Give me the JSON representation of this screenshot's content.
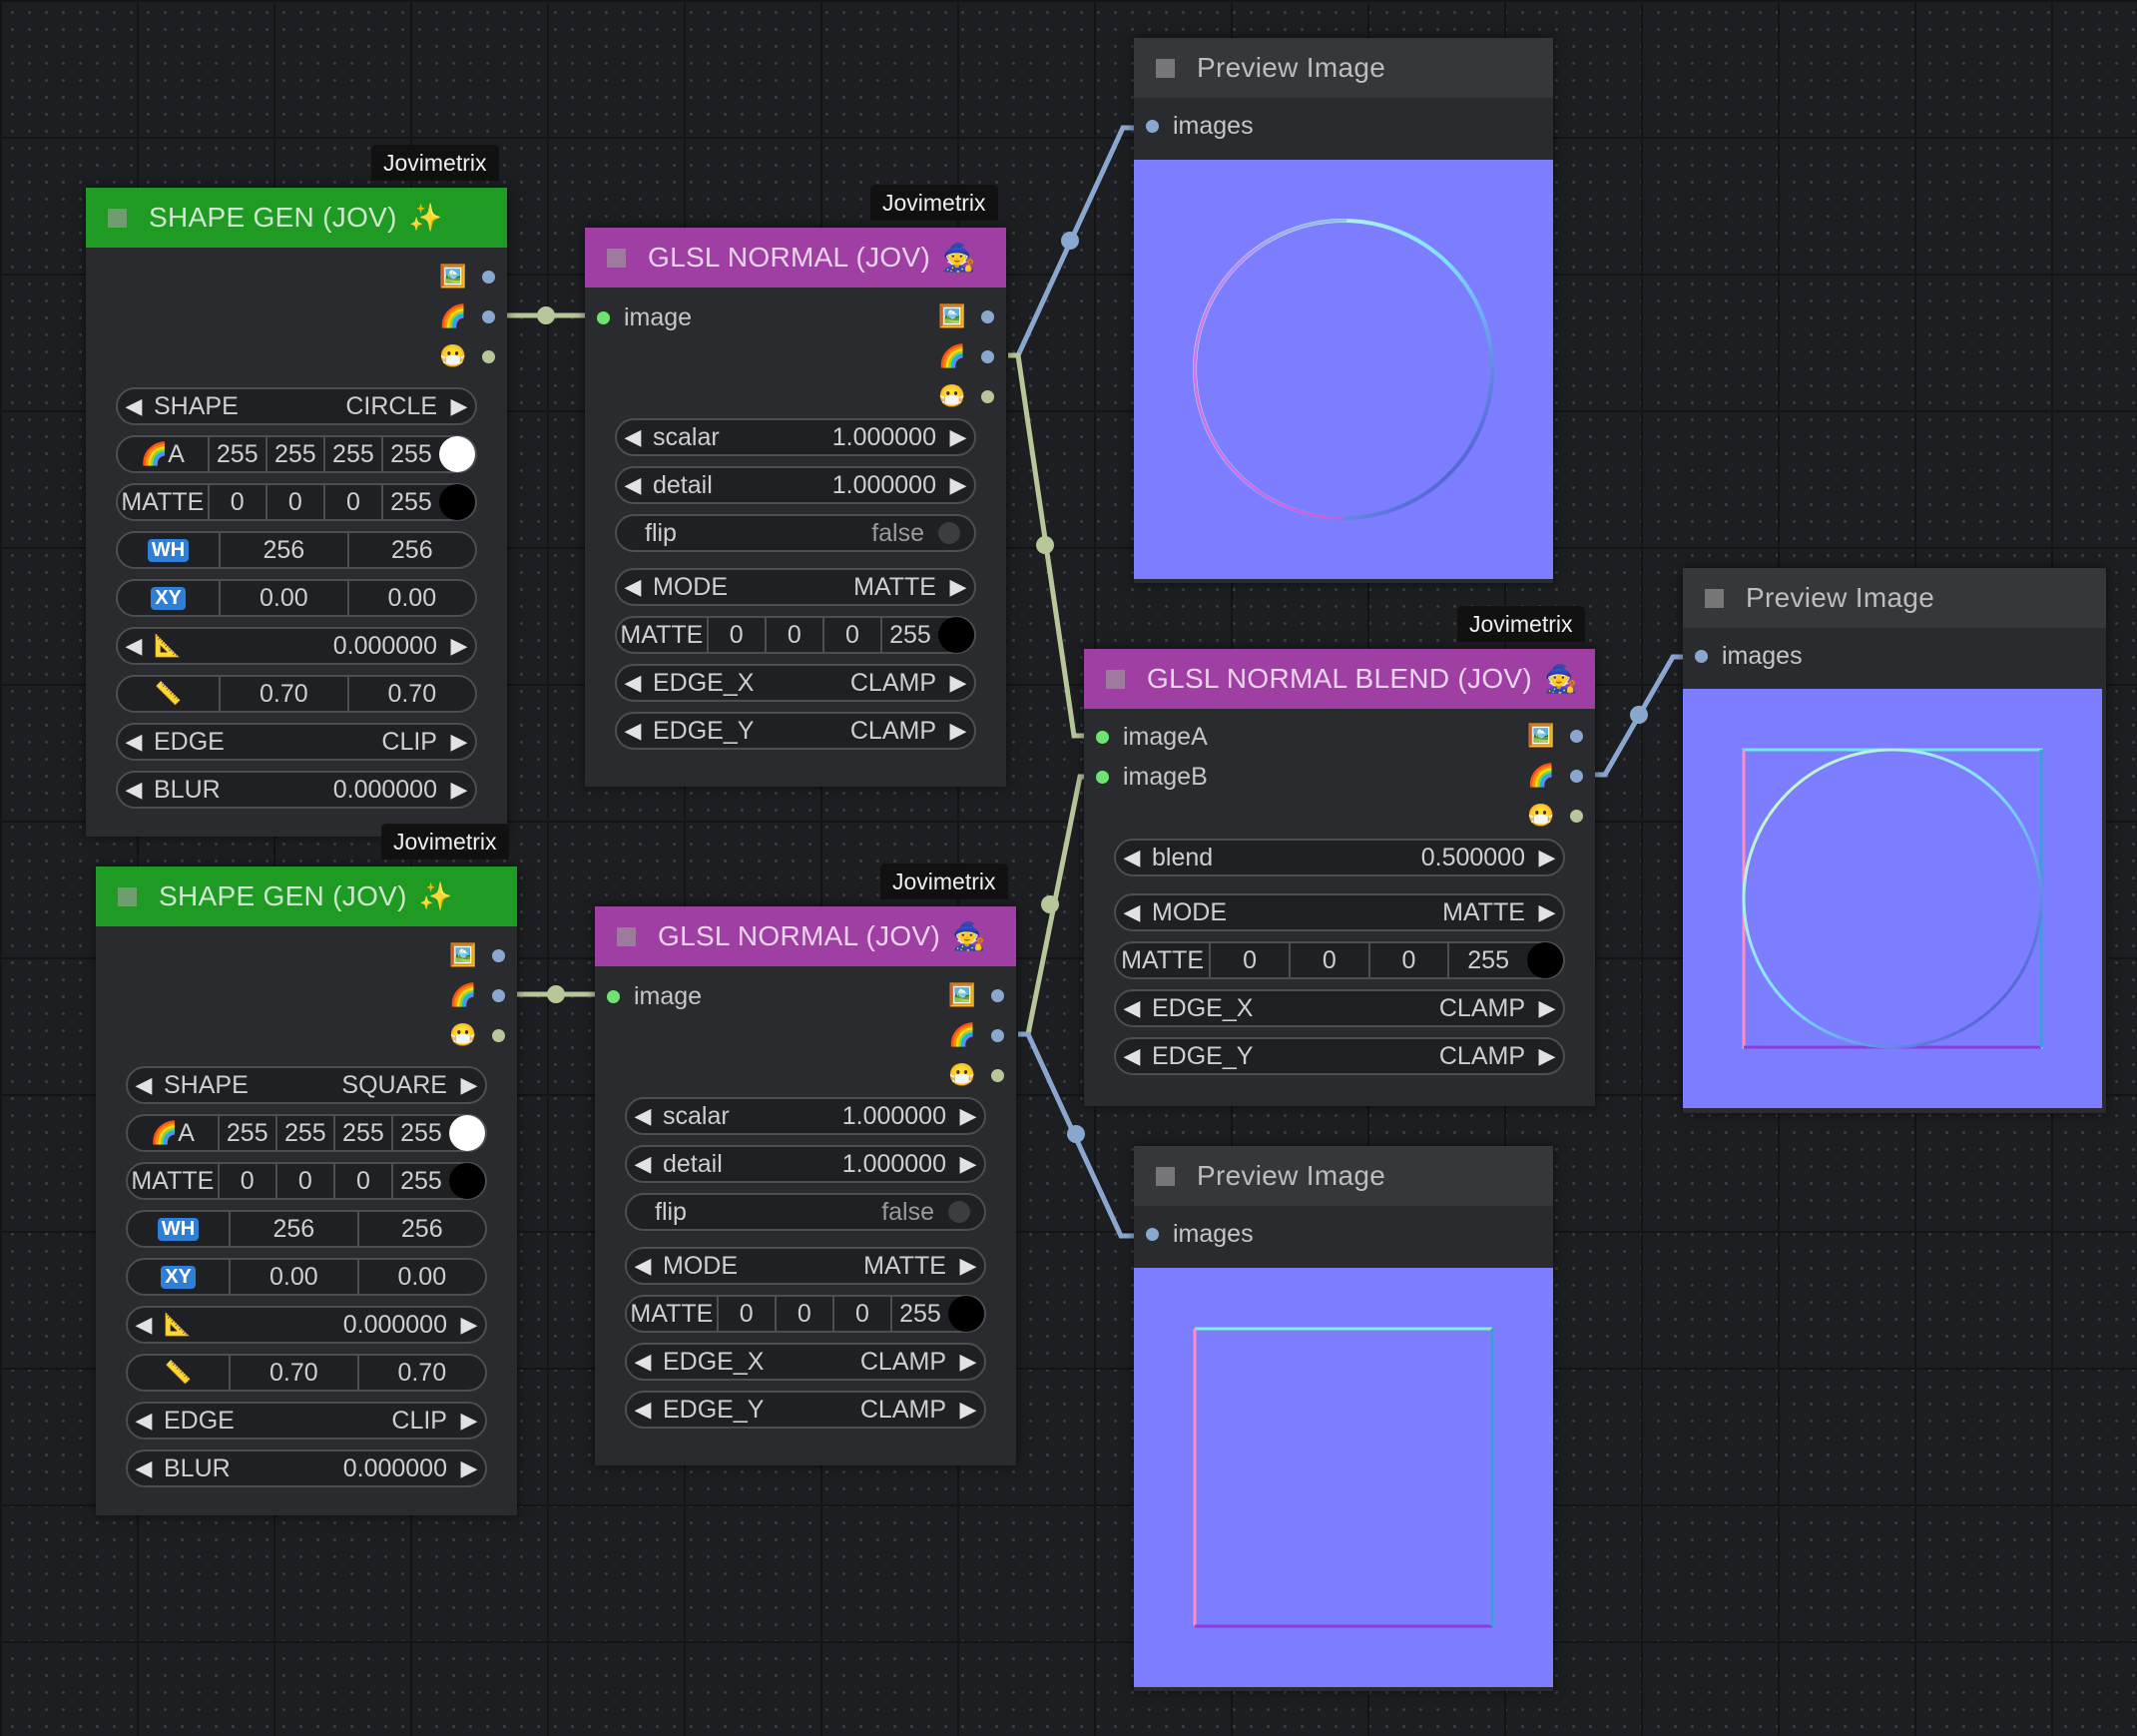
{
  "icons": {
    "image_out": "framed-picture-icon",
    "mask_out": "rainbow-icon",
    "alpha_out": "mask-face-icon",
    "shape_gen": "sparkles-icon",
    "glsl": "wizard-icon",
    "angle": "triangular-ruler-icon",
    "size": "straight-ruler-icon"
  },
  "colors": {
    "shape_header": "#1f9b24",
    "glsl_header": "#a03fa3",
    "preview_bg": "#7d7dff",
    "link_image": "#8aa8cf",
    "link_mask": "#b7c79a"
  },
  "shape1": {
    "badge": "Jovimetrix",
    "title": "SHAPE GEN (JOV)",
    "shape_label": "SHAPE",
    "shape_value": "CIRCLE",
    "rgba_label": "A",
    "rgba": [
      "255",
      "255",
      "255",
      "255"
    ],
    "matte_label": "MATTE",
    "matte": [
      "0",
      "0",
      "0",
      "255"
    ],
    "wh_label": "WH",
    "wh": [
      "256",
      "256"
    ],
    "xy_label": "XY",
    "xy": [
      "0.00",
      "0.00"
    ],
    "angle": "0.000000",
    "size": [
      "0.70",
      "0.70"
    ],
    "edge_label": "EDGE",
    "edge_value": "CLIP",
    "blur_label": "BLUR",
    "blur_value": "0.000000"
  },
  "shape2": {
    "badge": "Jovimetrix",
    "title": "SHAPE GEN (JOV)",
    "shape_label": "SHAPE",
    "shape_value": "SQUARE",
    "rgba_label": "A",
    "rgba": [
      "255",
      "255",
      "255",
      "255"
    ],
    "matte_label": "MATTE",
    "matte": [
      "0",
      "0",
      "0",
      "255"
    ],
    "wh_label": "WH",
    "wh": [
      "256",
      "256"
    ],
    "xy_label": "XY",
    "xy": [
      "0.00",
      "0.00"
    ],
    "angle": "0.000000",
    "size": [
      "0.70",
      "0.70"
    ],
    "edge_label": "EDGE",
    "edge_value": "CLIP",
    "blur_label": "BLUR",
    "blur_value": "0.000000"
  },
  "glsl1": {
    "badge": "Jovimetrix",
    "title": "GLSL NORMAL (JOV)",
    "input": "image",
    "scalar_label": "scalar",
    "scalar_value": "1.000000",
    "detail_label": "detail",
    "detail_value": "1.000000",
    "flip_label": "flip",
    "flip_value": "false",
    "mode_label": "MODE",
    "mode_value": "MATTE",
    "matte_label": "MATTE",
    "matte": [
      "0",
      "0",
      "0",
      "255"
    ],
    "edgex_label": "EDGE_X",
    "edgex_value": "CLAMP",
    "edgey_label": "EDGE_Y",
    "edgey_value": "CLAMP"
  },
  "glsl2": {
    "badge": "Jovimetrix",
    "title": "GLSL NORMAL (JOV)",
    "input": "image",
    "scalar_label": "scalar",
    "scalar_value": "1.000000",
    "detail_label": "detail",
    "detail_value": "1.000000",
    "flip_label": "flip",
    "flip_value": "false",
    "mode_label": "MODE",
    "mode_value": "MATTE",
    "matte_label": "MATTE",
    "matte": [
      "0",
      "0",
      "0",
      "255"
    ],
    "edgex_label": "EDGE_X",
    "edgex_value": "CLAMP",
    "edgey_label": "EDGE_Y",
    "edgey_value": "CLAMP"
  },
  "blend": {
    "badge": "Jovimetrix",
    "title": "GLSL NORMAL BLEND (JOV)",
    "input_a": "imageA",
    "input_b": "imageB",
    "blend_label": "blend",
    "blend_value": "0.500000",
    "mode_label": "MODE",
    "mode_value": "MATTE",
    "matte_label": "MATTE",
    "matte": [
      "0",
      "0",
      "0",
      "255"
    ],
    "edgex_label": "EDGE_X",
    "edgex_value": "CLAMP",
    "edgey_label": "EDGE_Y",
    "edgey_value": "CLAMP"
  },
  "preview1": {
    "title": "Preview Image",
    "input": "images"
  },
  "preview2": {
    "title": "Preview Image",
    "input": "images"
  },
  "preview3": {
    "title": "Preview Image",
    "input": "images"
  }
}
